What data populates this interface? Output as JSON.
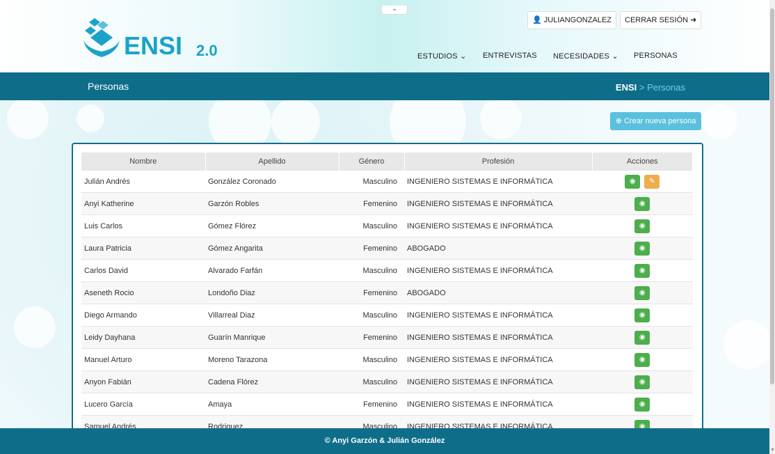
{
  "header": {
    "collapse_icon": "chevron-down-icon",
    "user_label": "JULIANGONZALEZ",
    "user_icon": "user-icon",
    "logout_label": "CERRAR SESIÓN",
    "logout_icon": "sign-out-icon",
    "logo_text": "ENSI",
    "logo_version": "2.0",
    "nav": {
      "estudios": "ESTUDIOS",
      "entrevistas": "ENTREVISTAS",
      "necesidades": "NECESIDADES",
      "personas": "PERSONAS"
    }
  },
  "titlebar": {
    "title": "Personas",
    "breadcrumb_root": "ENSI",
    "breadcrumb_sep": " > ",
    "breadcrumb_current": "Personas"
  },
  "create_button": {
    "label": "Crear nueva persona",
    "icon": "plus-circle-icon"
  },
  "table": {
    "headers": {
      "nombre": "Nombre",
      "apellido": "Apellido",
      "genero": "Género",
      "profesion": "Profesión",
      "acciones": "Acciones"
    },
    "rows": [
      {
        "nombre": "Julián Andrés",
        "apellido": "González Coronado",
        "genero": "Masculino",
        "profesion": "INGENIERO SISTEMAS E INFORMÁTICA",
        "editable": true
      },
      {
        "nombre": "Anyi Katherine",
        "apellido": "Garzón Robles",
        "genero": "Femenino",
        "profesion": "INGENIERO SISTEMAS E INFORMÁTICA"
      },
      {
        "nombre": "Luis Carlos",
        "apellido": "Gómez Flórez",
        "genero": "Masculino",
        "profesion": "INGENIERO SISTEMAS E INFORMÁTICA"
      },
      {
        "nombre": "Laura Patricia",
        "apellido": "Gómez Angarita",
        "genero": "Femenino",
        "profesion": "ABOGADO"
      },
      {
        "nombre": "Carlos David",
        "apellido": "Alvarado Farfán",
        "genero": "Masculino",
        "profesion": "INGENIERO SISTEMAS E INFORMÁTICA"
      },
      {
        "nombre": "Aseneth Rocio",
        "apellido": "Londoño Diaz",
        "genero": "Femenino",
        "profesion": "ABOGADO"
      },
      {
        "nombre": "Diego Armando",
        "apellido": "Villarreal Diaz",
        "genero": "Masculino",
        "profesion": "INGENIERO SISTEMAS E INFORMÁTICA"
      },
      {
        "nombre": "Leidy Dayhana",
        "apellido": "Guarín Manrique",
        "genero": "Femenino",
        "profesion": "INGENIERO SISTEMAS E INFORMÁTICA"
      },
      {
        "nombre": "Manuel Arturo",
        "apellido": "Moreno Tarazona",
        "genero": "Masculino",
        "profesion": "INGENIERO SISTEMAS E INFORMÁTICA"
      },
      {
        "nombre": "Anyon Fabián",
        "apellido": "Cadena Flórez",
        "genero": "Masculino",
        "profesion": "INGENIERO SISTEMAS E INFORMÁTICA"
      },
      {
        "nombre": "Lucero García",
        "apellido": "Amaya",
        "genero": "Femenino",
        "profesion": "INGENIERO SISTEMAS E INFORMÁTICA"
      },
      {
        "nombre": "Samuel Andrés",
        "apellido": "Rodriguez",
        "genero": "Masculino",
        "profesion": "INGENIERO SISTEMAS E INFORMÁTICA"
      }
    ],
    "view_icon": "eye-icon",
    "edit_icon": "edit-icon"
  },
  "footer": {
    "text": "© Anyi Garzón & Julián González"
  },
  "colors": {
    "primary": "#0e6e8a",
    "info": "#5bc0de",
    "success": "#4cae4c",
    "warning": "#f0ad4e",
    "logo": "#1aa3c8"
  }
}
